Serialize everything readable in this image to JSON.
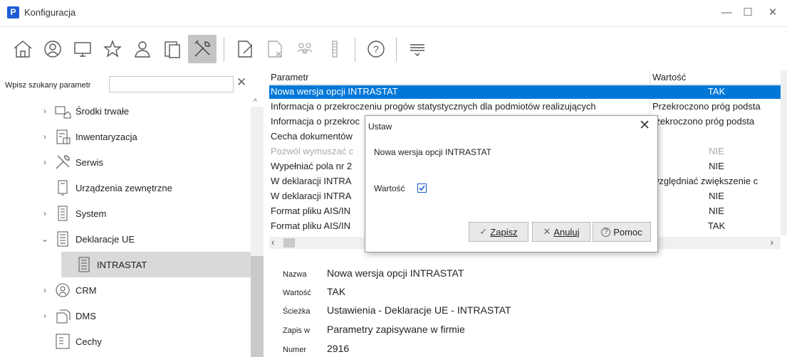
{
  "window": {
    "title": "Konfiguracja",
    "logo_letter": "P",
    "minimize": "—",
    "maximize": "☐",
    "close": "✕"
  },
  "toolbar": {
    "buttons": [
      {
        "name": "home-icon"
      },
      {
        "name": "contacts-icon"
      },
      {
        "name": "computer-icon"
      },
      {
        "name": "star-icon"
      },
      {
        "name": "user-icon"
      },
      {
        "name": "device-icon"
      },
      {
        "name": "tools-icon",
        "active": true
      },
      {
        "name": "edit-document-icon"
      },
      {
        "name": "delete-document-icon"
      },
      {
        "name": "group-icon"
      },
      {
        "name": "list-icon"
      },
      {
        "name": "help-icon"
      },
      {
        "name": "menu-icon"
      }
    ]
  },
  "search": {
    "label": "Wpisz szukany parametr",
    "value": "",
    "clear": "✕"
  },
  "tree": {
    "items": [
      {
        "label": "Środki trwałe",
        "chevron": "›",
        "icon": "fixed-assets-icon"
      },
      {
        "label": "Inwentaryzacja",
        "chevron": "›",
        "icon": "inventory-icon"
      },
      {
        "label": "Serwis",
        "chevron": "›",
        "icon": "service-icon"
      },
      {
        "label": "Urządzenia zewnętrzne",
        "chevron": "",
        "icon": "external-device-icon"
      },
      {
        "label": "System",
        "chevron": "›",
        "icon": "system-icon"
      },
      {
        "label": "Deklaracje UE",
        "chevron": "⌄",
        "icon": "declarations-icon"
      },
      {
        "label": "INTRASTAT",
        "chevron": "",
        "icon": "intrastat-icon",
        "selected": true
      },
      {
        "label": "CRM",
        "chevron": "›",
        "icon": "crm-icon"
      },
      {
        "label": "DMS",
        "chevron": "›",
        "icon": "dms-icon"
      },
      {
        "label": "Cechy",
        "chevron": "",
        "icon": "features-icon"
      }
    ]
  },
  "grid": {
    "headers": {
      "parametr": "Parametr",
      "wartosc": "Wartość"
    },
    "rows": [
      {
        "param": "Nowa wersja opcji INTRASTAT",
        "value": "TAK",
        "selected": true
      },
      {
        "param": "Informacja o przekroczeniu progów statystycznych dla podmiotów realizujących",
        "value": "Przekroczono próg podsta"
      },
      {
        "param": "Informacja o przekroc",
        "value": "rzekroczono próg podsta"
      },
      {
        "param": "Cecha dokumentów",
        "value": ""
      },
      {
        "param": "Pozwól wymuszać c",
        "value": "NIE",
        "dim": true
      },
      {
        "param": "Wypełniać pola nr 2",
        "value": "NIE"
      },
      {
        "param": "W deklaracji INTRA",
        "value": "względniać zwiększenie c"
      },
      {
        "param": "W deklaracji INTRA",
        "value": "NIE"
      },
      {
        "param": "Format pliku AIS/IN",
        "value": "NIE"
      },
      {
        "param": "Format pliku AIS/IN",
        "value": "TAK"
      }
    ]
  },
  "dialog": {
    "title": "Ustaw",
    "close": "✕",
    "parameter_name": "Nowa wersja opcji INTRASTAT",
    "field_label": "Wartość",
    "checked": true,
    "buttons": {
      "save": "Zapisz",
      "cancel": "Anuluj",
      "help": "Pomoc"
    }
  },
  "details": {
    "rows": [
      {
        "key": "Nazwa",
        "value": "Nowa wersja opcji INTRASTAT"
      },
      {
        "key": "Wartość",
        "value": "TAK"
      },
      {
        "key": "Ścieżka",
        "value": "Ustawienia - Deklaracje UE - INTRASTAT"
      },
      {
        "key": "Zapis w",
        "value": "Parametry zapisywane w firmie"
      },
      {
        "key": "Numer",
        "value": "2916"
      }
    ]
  },
  "colors": {
    "selection": "#0078d7",
    "accent": "#1e5bd6",
    "active_toolbar": "#c4c4c4",
    "tree_selected": "#d9d9d9"
  }
}
